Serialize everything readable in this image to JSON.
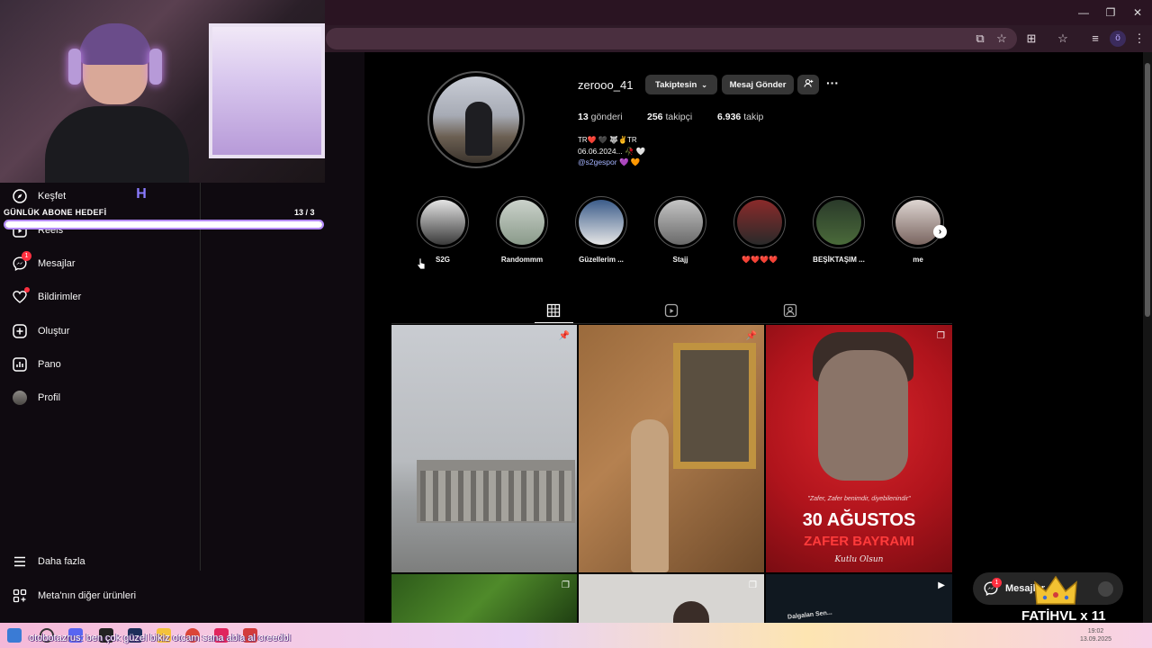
{
  "browser": {
    "window_controls": [
      "—",
      "❐",
      "✕"
    ],
    "profile_initial": "ö"
  },
  "webcam": {
    "goal_label": "GÜNLÜK ABONE HEDEFİ",
    "goal_count": "13 / 3",
    "goal_progress": 1.0
  },
  "sidebar": {
    "items": [
      {
        "label": "Keşfet",
        "icon": "compass-icon"
      },
      {
        "label": "Reels",
        "icon": "reels-icon"
      },
      {
        "label": "Mesajlar",
        "icon": "messenger-icon",
        "badge": "1"
      },
      {
        "label": "Bildirimler",
        "icon": "heart-icon"
      },
      {
        "label": "Oluştur",
        "icon": "plus-square-icon"
      },
      {
        "label": "Pano",
        "icon": "chart-icon"
      },
      {
        "label": "Profil",
        "icon": "avatar"
      }
    ],
    "bottom_items": [
      {
        "label": "Daha fazla",
        "icon": "menu-icon"
      },
      {
        "label": "Meta'nın diğer ürünleri",
        "icon": "grid-icon"
      }
    ]
  },
  "profile": {
    "username": "zerooo_41",
    "following_button": "Takiptesin",
    "message_button": "Mesaj Gönder",
    "stats": {
      "posts_count": "13",
      "posts_label": "gönderi",
      "followers_count": "256",
      "followers_label": "takipçi",
      "following_count": "6.936",
      "following_label": "takip"
    },
    "bio": {
      "line1": "TR❤️ 🖤 🐺✌️TR",
      "line2": "06.06.2024... 🥀 🤍",
      "line3": "@s2gespor 💜 🧡"
    }
  },
  "highlights": [
    {
      "label": "S2G",
      "color": "#cfcfcf"
    },
    {
      "label": "Randommm",
      "color": "#a9b4a9"
    },
    {
      "label": "Güzellerim ...",
      "color": "#4a6c9a"
    },
    {
      "label": "Stajj",
      "color": "#8e8e8e"
    },
    {
      "label": "❤️❤️❤️❤️",
      "color": "#5d3a3a"
    },
    {
      "label": "BEŞİKTAŞIM ...",
      "color": "#3b5a3b"
    },
    {
      "label": "me",
      "color": "#b9a7a0"
    }
  ],
  "posts": {
    "p3_quote": "\"Zafer, Zafer benimdir, diyebilenindir\"",
    "p3_title": "30 AĞUSTOS",
    "p3_subtitle": "ZAFER BAYRAMI",
    "p3_script": "Kutlu Olsun",
    "p6_text": "Dalgalan Sen..."
  },
  "messages_float": {
    "label": "Mesajlar",
    "badge": "1"
  },
  "overlay": {
    "donor": "FATİHVL x 11",
    "chat": "otobotazrus: ben çok güzel bikiz otcam sana abla al creedbl"
  },
  "taskbar": {
    "time": "19:02",
    "date": "13.09.2025"
  }
}
